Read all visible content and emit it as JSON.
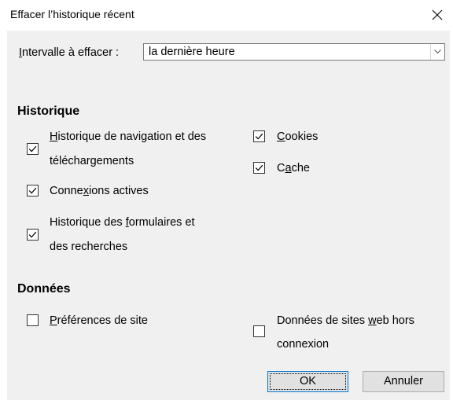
{
  "window": {
    "title": "Effacer l’historique récent",
    "close_icon": "close-icon"
  },
  "range": {
    "label_mnemonic": "I",
    "label_rest": "ntervalle à effacer :",
    "value": "la dernière heure",
    "arrow_icon": "chevron-down-icon"
  },
  "history": {
    "title": "Historique",
    "items": [
      {
        "checked": true,
        "pre": "",
        "mn": "H",
        "post": "istorique de navigation et des",
        "line2": "téléchargements"
      },
      {
        "checked": true,
        "pre": "Conne",
        "mn": "x",
        "post": "ions actives",
        "line2": ""
      },
      {
        "checked": true,
        "pre": "Historique des ",
        "mn": "f",
        "post": "ormulaires et",
        "line2": "des recherches"
      },
      {
        "checked": true,
        "pre": "",
        "mn": "C",
        "post": "ookies",
        "line2": ""
      },
      {
        "checked": true,
        "pre": "C",
        "mn": "a",
        "post": "che",
        "line2": ""
      }
    ]
  },
  "data": {
    "title": "Données",
    "items": [
      {
        "checked": false,
        "pre": "",
        "mn": "P",
        "post": "références de site",
        "line2": ""
      },
      {
        "checked": false,
        "pre": "Données de sites ",
        "mn": "w",
        "post": "eb hors",
        "line2": "connexion"
      }
    ]
  },
  "buttons": {
    "ok": "OK",
    "cancel": "Annuler"
  },
  "colors": {
    "dialog_bg": "#f0f0f0",
    "focus_border": "#0078d7"
  }
}
